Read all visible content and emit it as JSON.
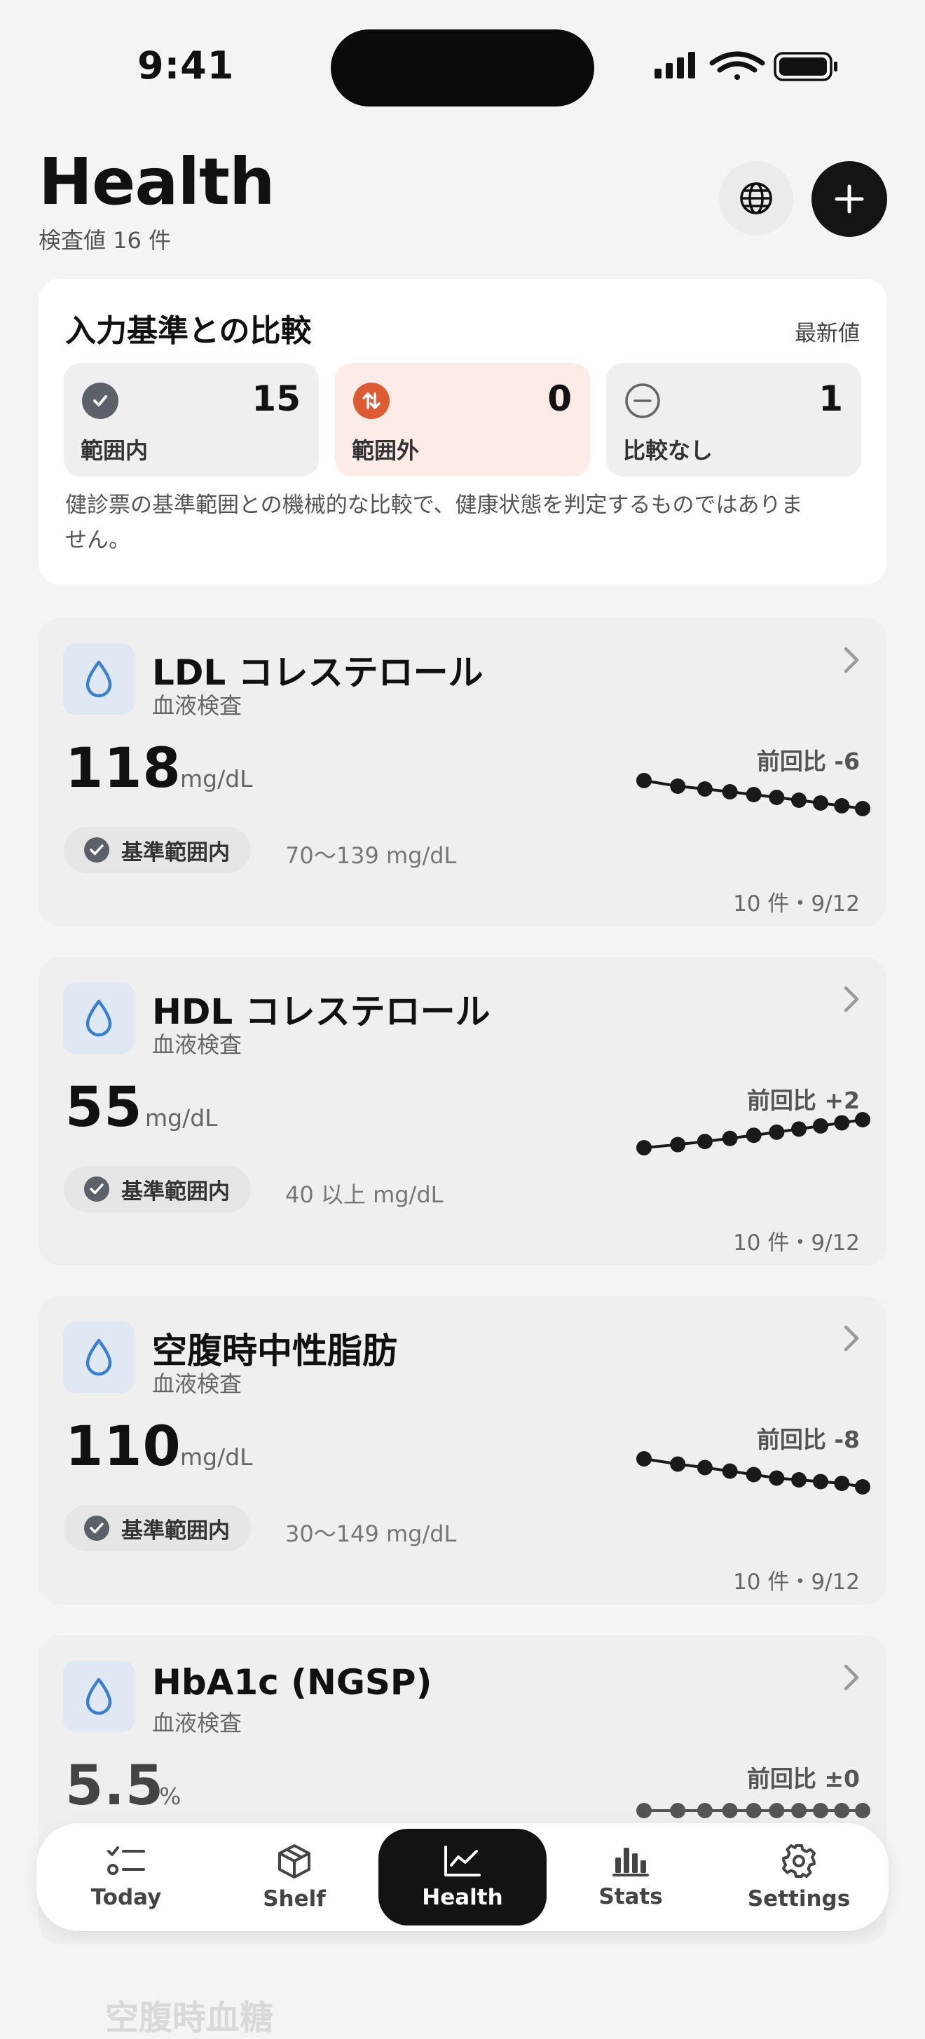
{
  "status": {
    "time": "9:41"
  },
  "header": {
    "title": "Health",
    "subtitle": "検査値 16 件",
    "globe_icon": "globe-icon",
    "add_icon": "plus-icon"
  },
  "summary": {
    "title": "入力基準との比較",
    "latest_label": "最新値",
    "tiles": [
      {
        "label": "範囲内",
        "count": "15",
        "icon": "check-circle-icon",
        "bg": "#efefef",
        "icon_bg": "#5b6069"
      },
      {
        "label": "範囲外",
        "count": "0",
        "icon": "arrows-up-down-icon",
        "bg": "#fcebe6",
        "icon_bg": "#dd5a33"
      },
      {
        "label": "比較なし",
        "count": "1",
        "icon": "minus-circle-icon",
        "bg": "#efefef",
        "icon_bg": "none"
      }
    ],
    "note": "健診票の基準範囲との機械的な比較で、健康状態を判定するものではありません。"
  },
  "items": [
    {
      "name": "LDL コレステロール",
      "category": "血液検査",
      "value": "118",
      "unit": "mg/dL",
      "diff": "前回比 -6",
      "status": "基準範囲内",
      "range": "70〜139 mg/dL",
      "meta": "10 件・9/12",
      "trend": [
        128,
        126,
        125,
        124,
        123,
        122,
        121,
        120,
        119,
        118
      ]
    },
    {
      "name": "HDL コレステロール",
      "category": "血液検査",
      "value": "55",
      "unit": "mg/dL",
      "diff": "前回比 +2",
      "status": "基準範囲内",
      "range": "40 以上 mg/dL",
      "meta": "10 件・9/12",
      "trend": [
        46,
        47,
        48,
        49,
        50,
        51,
        52,
        53,
        54,
        55
      ]
    },
    {
      "name": "空腹時中性脂肪",
      "category": "血液検査",
      "value": "110",
      "unit": "mg/dL",
      "diff": "前回比 -8",
      "status": "基準範囲内",
      "range": "30〜149 mg/dL",
      "meta": "10 件・9/12",
      "trend": [
        126,
        123,
        121,
        119,
        117,
        115,
        114,
        113,
        112,
        110
      ]
    },
    {
      "name": "HbA1c (NGSP)",
      "category": "血液検査",
      "value": "5.5",
      "unit": "%",
      "diff": "前回比 ±0",
      "status": "",
      "range": "",
      "meta": "",
      "trend": [
        5.5,
        5.5,
        5.5,
        5.5,
        5.5,
        5.5,
        5.5,
        5.5,
        5.5,
        5.5
      ]
    }
  ],
  "tabbar": {
    "tabs": [
      {
        "label": "Today",
        "icon": "checklist-icon"
      },
      {
        "label": "Shelf",
        "icon": "box-icon"
      },
      {
        "label": "Health",
        "icon": "chart-line-icon"
      },
      {
        "label": "Stats",
        "icon": "bar-chart-icon"
      },
      {
        "label": "Settings",
        "icon": "gear-icon"
      }
    ],
    "active": "Health"
  },
  "ghost_item": "空腹時血糖"
}
